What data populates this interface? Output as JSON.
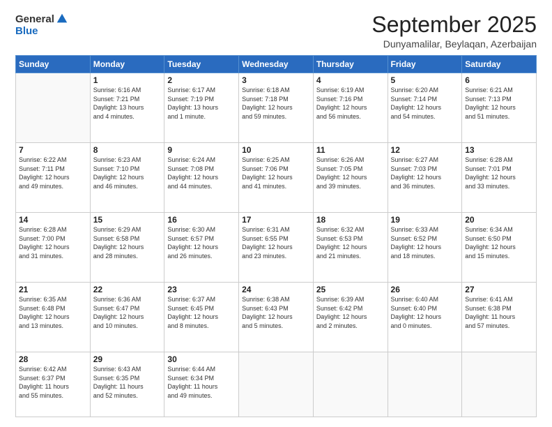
{
  "logo": {
    "general": "General",
    "blue": "Blue"
  },
  "header": {
    "month": "September 2025",
    "location": "Dunyamalilar, Beylaqan, Azerbaijan"
  },
  "weekdays": [
    "Sunday",
    "Monday",
    "Tuesday",
    "Wednesday",
    "Thursday",
    "Friday",
    "Saturday"
  ],
  "weeks": [
    [
      {
        "day": "",
        "info": ""
      },
      {
        "day": "1",
        "info": "Sunrise: 6:16 AM\nSunset: 7:21 PM\nDaylight: 13 hours\nand 4 minutes."
      },
      {
        "day": "2",
        "info": "Sunrise: 6:17 AM\nSunset: 7:19 PM\nDaylight: 13 hours\nand 1 minute."
      },
      {
        "day": "3",
        "info": "Sunrise: 6:18 AM\nSunset: 7:18 PM\nDaylight: 12 hours\nand 59 minutes."
      },
      {
        "day": "4",
        "info": "Sunrise: 6:19 AM\nSunset: 7:16 PM\nDaylight: 12 hours\nand 56 minutes."
      },
      {
        "day": "5",
        "info": "Sunrise: 6:20 AM\nSunset: 7:14 PM\nDaylight: 12 hours\nand 54 minutes."
      },
      {
        "day": "6",
        "info": "Sunrise: 6:21 AM\nSunset: 7:13 PM\nDaylight: 12 hours\nand 51 minutes."
      }
    ],
    [
      {
        "day": "7",
        "info": "Sunrise: 6:22 AM\nSunset: 7:11 PM\nDaylight: 12 hours\nand 49 minutes."
      },
      {
        "day": "8",
        "info": "Sunrise: 6:23 AM\nSunset: 7:10 PM\nDaylight: 12 hours\nand 46 minutes."
      },
      {
        "day": "9",
        "info": "Sunrise: 6:24 AM\nSunset: 7:08 PM\nDaylight: 12 hours\nand 44 minutes."
      },
      {
        "day": "10",
        "info": "Sunrise: 6:25 AM\nSunset: 7:06 PM\nDaylight: 12 hours\nand 41 minutes."
      },
      {
        "day": "11",
        "info": "Sunrise: 6:26 AM\nSunset: 7:05 PM\nDaylight: 12 hours\nand 39 minutes."
      },
      {
        "day": "12",
        "info": "Sunrise: 6:27 AM\nSunset: 7:03 PM\nDaylight: 12 hours\nand 36 minutes."
      },
      {
        "day": "13",
        "info": "Sunrise: 6:28 AM\nSunset: 7:01 PM\nDaylight: 12 hours\nand 33 minutes."
      }
    ],
    [
      {
        "day": "14",
        "info": "Sunrise: 6:28 AM\nSunset: 7:00 PM\nDaylight: 12 hours\nand 31 minutes."
      },
      {
        "day": "15",
        "info": "Sunrise: 6:29 AM\nSunset: 6:58 PM\nDaylight: 12 hours\nand 28 minutes."
      },
      {
        "day": "16",
        "info": "Sunrise: 6:30 AM\nSunset: 6:57 PM\nDaylight: 12 hours\nand 26 minutes."
      },
      {
        "day": "17",
        "info": "Sunrise: 6:31 AM\nSunset: 6:55 PM\nDaylight: 12 hours\nand 23 minutes."
      },
      {
        "day": "18",
        "info": "Sunrise: 6:32 AM\nSunset: 6:53 PM\nDaylight: 12 hours\nand 21 minutes."
      },
      {
        "day": "19",
        "info": "Sunrise: 6:33 AM\nSunset: 6:52 PM\nDaylight: 12 hours\nand 18 minutes."
      },
      {
        "day": "20",
        "info": "Sunrise: 6:34 AM\nSunset: 6:50 PM\nDaylight: 12 hours\nand 15 minutes."
      }
    ],
    [
      {
        "day": "21",
        "info": "Sunrise: 6:35 AM\nSunset: 6:48 PM\nDaylight: 12 hours\nand 13 minutes."
      },
      {
        "day": "22",
        "info": "Sunrise: 6:36 AM\nSunset: 6:47 PM\nDaylight: 12 hours\nand 10 minutes."
      },
      {
        "day": "23",
        "info": "Sunrise: 6:37 AM\nSunset: 6:45 PM\nDaylight: 12 hours\nand 8 minutes."
      },
      {
        "day": "24",
        "info": "Sunrise: 6:38 AM\nSunset: 6:43 PM\nDaylight: 12 hours\nand 5 minutes."
      },
      {
        "day": "25",
        "info": "Sunrise: 6:39 AM\nSunset: 6:42 PM\nDaylight: 12 hours\nand 2 minutes."
      },
      {
        "day": "26",
        "info": "Sunrise: 6:40 AM\nSunset: 6:40 PM\nDaylight: 12 hours\nand 0 minutes."
      },
      {
        "day": "27",
        "info": "Sunrise: 6:41 AM\nSunset: 6:38 PM\nDaylight: 11 hours\nand 57 minutes."
      }
    ],
    [
      {
        "day": "28",
        "info": "Sunrise: 6:42 AM\nSunset: 6:37 PM\nDaylight: 11 hours\nand 55 minutes."
      },
      {
        "day": "29",
        "info": "Sunrise: 6:43 AM\nSunset: 6:35 PM\nDaylight: 11 hours\nand 52 minutes."
      },
      {
        "day": "30",
        "info": "Sunrise: 6:44 AM\nSunset: 6:34 PM\nDaylight: 11 hours\nand 49 minutes."
      },
      {
        "day": "",
        "info": ""
      },
      {
        "day": "",
        "info": ""
      },
      {
        "day": "",
        "info": ""
      },
      {
        "day": "",
        "info": ""
      }
    ]
  ]
}
